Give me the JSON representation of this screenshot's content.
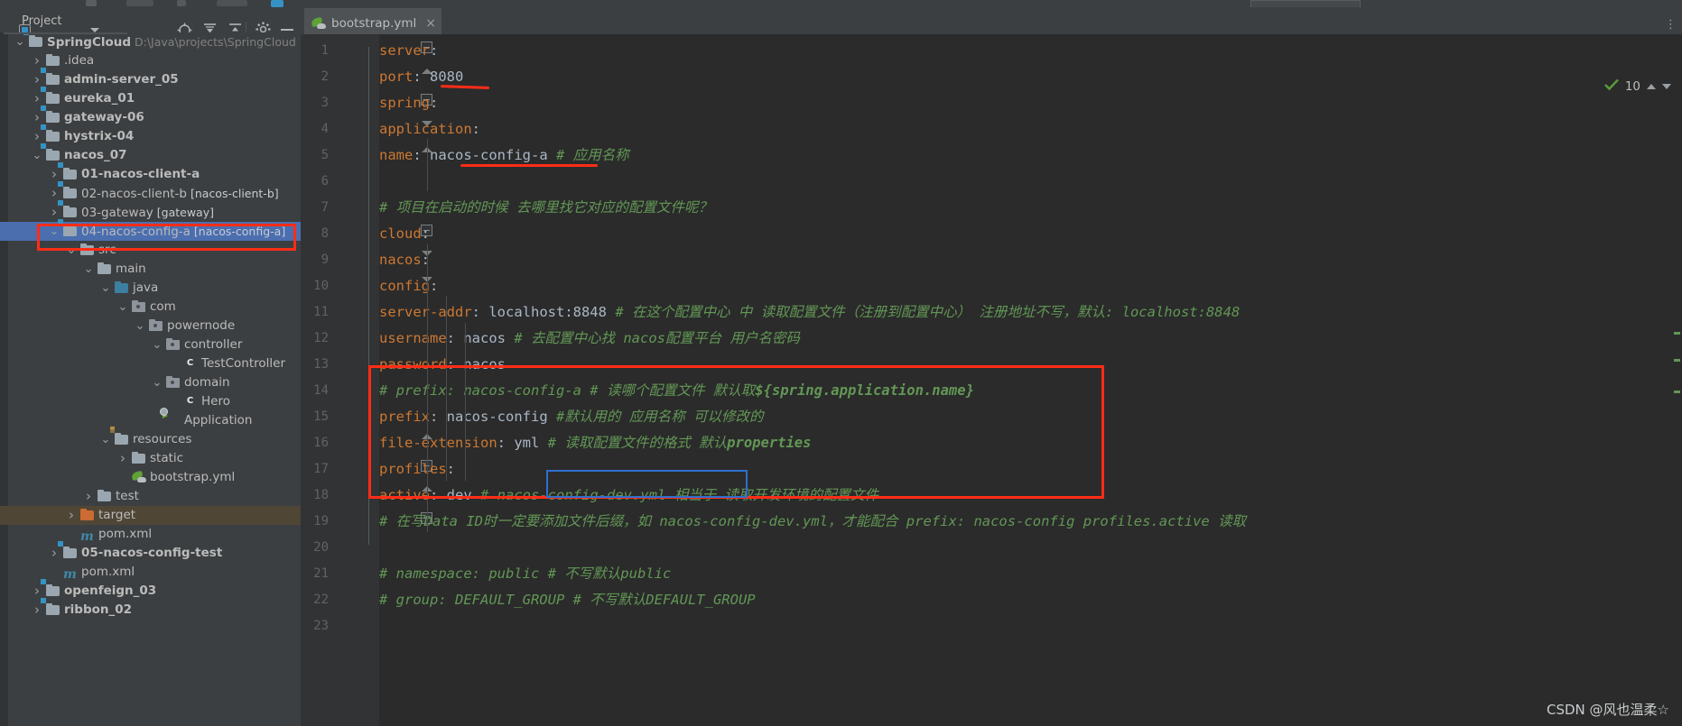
{
  "window": {
    "project_panel_title": "Project",
    "project_icon": "project-window-icon",
    "header_icons": [
      "locate-icon",
      "expand-all-icon",
      "collapse-all-icon",
      "settings-gear-icon",
      "hide-icon"
    ]
  },
  "tabs": [
    {
      "label": "bootstrap.yml",
      "icon": "yaml-file-icon",
      "close": "×",
      "active": true
    }
  ],
  "inspections": {
    "count": "10",
    "icon": "check-mark-icon"
  },
  "tree": [
    {
      "indent": 0,
      "twisty": "⌄",
      "icon": "module-folder-icon",
      "label": "SpringCloud",
      "bold": true,
      "dim": "D:\\Java\\projects\\SpringCloud"
    },
    {
      "indent": 1,
      "twisty": "›",
      "icon": "folder-icon",
      "label": ".idea",
      "bold": false,
      "dim": ""
    },
    {
      "indent": 1,
      "twisty": "›",
      "icon": "module-folder-icon",
      "label": "admin-server_05",
      "bold": true,
      "dim": ""
    },
    {
      "indent": 1,
      "twisty": "›",
      "icon": "module-folder-icon",
      "label": "eureka_01",
      "bold": true,
      "dim": ""
    },
    {
      "indent": 1,
      "twisty": "›",
      "icon": "module-folder-icon",
      "label": "gateway-06",
      "bold": true,
      "dim": ""
    },
    {
      "indent": 1,
      "twisty": "›",
      "icon": "module-folder-icon",
      "label": "hystrix-04",
      "bold": true,
      "dim": ""
    },
    {
      "indent": 1,
      "twisty": "⌄",
      "icon": "module-folder-icon",
      "label": "nacos_07",
      "bold": true,
      "dim": ""
    },
    {
      "indent": 2,
      "twisty": "›",
      "icon": "module-folder-icon",
      "label": "01-nacos-client-a",
      "bold": true,
      "dim": ""
    },
    {
      "indent": 2,
      "twisty": "›",
      "icon": "module-folder-icon",
      "label": "02-nacos-client-b",
      "bold": false,
      "dim": "[nacos-client-b]",
      "dim_bold": true
    },
    {
      "indent": 2,
      "twisty": "›",
      "icon": "module-folder-icon",
      "label": "03-gateway",
      "bold": false,
      "dim": "[gateway]",
      "dim_bold": true
    },
    {
      "indent": 2,
      "twisty": "⌄",
      "icon": "module-folder-icon",
      "label": "04-nacos-config-a",
      "bold": false,
      "dim": "[nacos-config-a]",
      "dim_bold": true,
      "selected": true
    },
    {
      "indent": 3,
      "twisty": "⌄",
      "icon": "folder-icon",
      "label": "src",
      "bold": false,
      "dim": ""
    },
    {
      "indent": 4,
      "twisty": "⌄",
      "icon": "folder-icon",
      "label": "main",
      "bold": false,
      "dim": ""
    },
    {
      "indent": 5,
      "twisty": "⌄",
      "icon": "source-folder-icon",
      "label": "java",
      "bold": false,
      "dim": ""
    },
    {
      "indent": 6,
      "twisty": "⌄",
      "icon": "package-icon",
      "label": "com",
      "bold": false,
      "dim": ""
    },
    {
      "indent": 7,
      "twisty": "⌄",
      "icon": "package-icon",
      "label": "powernode",
      "bold": false,
      "dim": ""
    },
    {
      "indent": 8,
      "twisty": "⌄",
      "icon": "package-icon",
      "label": "controller",
      "bold": false,
      "dim": ""
    },
    {
      "indent": 9,
      "twisty": "",
      "icon": "java-class-icon",
      "label": "TestController",
      "bold": false,
      "dim": ""
    },
    {
      "indent": 8,
      "twisty": "⌄",
      "icon": "package-icon",
      "label": "domain",
      "bold": false,
      "dim": ""
    },
    {
      "indent": 9,
      "twisty": "",
      "icon": "java-class-icon",
      "label": "Hero",
      "bold": false,
      "dim": ""
    },
    {
      "indent": 8,
      "twisty": "",
      "icon": "spring-boot-app-icon",
      "label": "Application",
      "bold": false,
      "dim": ""
    },
    {
      "indent": 5,
      "twisty": "⌄",
      "icon": "resources-folder-icon",
      "label": "resources",
      "bold": false,
      "dim": ""
    },
    {
      "indent": 6,
      "twisty": "›",
      "icon": "folder-icon",
      "label": "static",
      "bold": false,
      "dim": ""
    },
    {
      "indent": 6,
      "twisty": "",
      "icon": "yaml-file-icon",
      "label": "bootstrap.yml",
      "bold": false,
      "dim": ""
    },
    {
      "indent": 4,
      "twisty": "›",
      "icon": "folder-icon",
      "label": "test",
      "bold": false,
      "dim": ""
    },
    {
      "indent": 3,
      "twisty": "›",
      "icon": "target-folder-icon",
      "label": "target",
      "bold": false,
      "dim": "",
      "highlight": true
    },
    {
      "indent": 3,
      "twisty": "",
      "icon": "maven-pom-icon",
      "label": "pom.xml",
      "bold": false,
      "dim": ""
    },
    {
      "indent": 2,
      "twisty": "›",
      "icon": "module-folder-icon",
      "label": "05-nacos-config-test",
      "bold": true,
      "dim": ""
    },
    {
      "indent": 2,
      "twisty": "",
      "icon": "maven-pom-icon",
      "label": "pom.xml",
      "bold": false,
      "dim": ""
    },
    {
      "indent": 1,
      "twisty": "›",
      "icon": "module-folder-icon",
      "label": "openfeign_03",
      "bold": true,
      "dim": ""
    },
    {
      "indent": 1,
      "twisty": "›",
      "icon": "module-folder-icon",
      "label": "ribbon_02",
      "bold": true,
      "dim": ""
    }
  ],
  "editor": {
    "filename": "bootstrap.yml",
    "lines": [
      {
        "n": "1",
        "segs": [
          {
            "t": "server",
            "c": "k"
          },
          {
            "t": ":",
            "c": "p"
          }
        ],
        "indent": 0
      },
      {
        "n": "2",
        "segs": [
          {
            "t": "  port",
            "c": "k"
          },
          {
            "t": ": ",
            "c": "p"
          },
          {
            "t": "8080",
            "c": "v"
          }
        ],
        "indent": 0
      },
      {
        "n": "3",
        "segs": [
          {
            "t": "spring",
            "c": "k"
          },
          {
            "t": ":",
            "c": "p"
          }
        ],
        "indent": 0
      },
      {
        "n": "4",
        "segs": [
          {
            "t": "  application",
            "c": "k"
          },
          {
            "t": ":",
            "c": "p"
          }
        ],
        "indent": 0
      },
      {
        "n": "5",
        "segs": [
          {
            "t": "    name",
            "c": "k"
          },
          {
            "t": ": ",
            "c": "p"
          },
          {
            "t": "nacos-config-a",
            "c": "v"
          },
          {
            "t": " # 应用名称",
            "c": "c"
          }
        ],
        "indent": 0
      },
      {
        "n": "6",
        "segs": [],
        "indent": 0
      },
      {
        "n": "7",
        "segs": [
          {
            "t": "  # 项目在启动的时候  去哪里找它对应的配置文件呢？",
            "c": "c"
          }
        ],
        "indent": 0
      },
      {
        "n": "8",
        "segs": [
          {
            "t": "  cloud",
            "c": "k"
          },
          {
            "t": ":",
            "c": "p"
          }
        ],
        "indent": 0
      },
      {
        "n": "9",
        "segs": [
          {
            "t": "    nacos",
            "c": "k"
          },
          {
            "t": ":",
            "c": "p"
          }
        ],
        "indent": 0
      },
      {
        "n": "10",
        "segs": [
          {
            "t": "      config",
            "c": "k"
          },
          {
            "t": ":",
            "c": "p"
          }
        ],
        "indent": 0
      },
      {
        "n": "11",
        "segs": [
          {
            "t": "        server-addr",
            "c": "k"
          },
          {
            "t": ": ",
            "c": "p"
          },
          {
            "t": "localhost:8848",
            "c": "v"
          },
          {
            "t": "     # 在这个配置中心 中 读取配置文件（注册到配置中心）  注册地址不写，默认: localhost:8848",
            "c": "c"
          }
        ],
        "indent": 0
      },
      {
        "n": "12",
        "segs": [
          {
            "t": "        username",
            "c": "k"
          },
          {
            "t": ": ",
            "c": "p"
          },
          {
            "t": "nacos",
            "c": "v"
          },
          {
            "t": "    # 去配置中心找 nacos配置平台 用户名密码",
            "c": "c"
          }
        ],
        "indent": 0
      },
      {
        "n": "13",
        "segs": [
          {
            "t": "        password",
            "c": "k"
          },
          {
            "t": ": ",
            "c": "p"
          },
          {
            "t": "nacos",
            "c": "v"
          }
        ],
        "indent": 0
      },
      {
        "n": "14",
        "segs": [
          {
            "t": "#        prefix: nacos-config-a # 读哪个配置文件    默认取",
            "c": "c"
          },
          {
            "t": "${spring.application.name}",
            "c": "cb"
          }
        ],
        "indent": 0
      },
      {
        "n": "15",
        "segs": [
          {
            "t": "        prefix",
            "c": "k"
          },
          {
            "t": ": ",
            "c": "p"
          },
          {
            "t": "nacos-config",
            "c": "v"
          },
          {
            "t": " #默认用的 应用名称 可以修改的",
            "c": "c"
          }
        ],
        "indent": 0
      },
      {
        "n": "16",
        "segs": [
          {
            "t": "        file-extension",
            "c": "k"
          },
          {
            "t": ": ",
            "c": "p"
          },
          {
            "t": "yml",
            "c": "v"
          },
          {
            "t": "    # 读取配置文件的格式    默认",
            "c": "c"
          },
          {
            "t": "properties",
            "c": "cb"
          }
        ],
        "indent": 0
      },
      {
        "n": "17",
        "segs": [
          {
            "t": "    profiles",
            "c": "k"
          },
          {
            "t": ":",
            "c": "p"
          }
        ],
        "indent": 0
      },
      {
        "n": "18",
        "segs": [
          {
            "t": "      active",
            "c": "k"
          },
          {
            "t": ": ",
            "c": "p"
          },
          {
            "t": "dev",
            "c": "v"
          },
          {
            "t": "   # ",
            "c": "c"
          },
          {
            "t": "nacos-config-dev.yml",
            "c": "c"
          },
          {
            "t": "  相当于  读取开发环境的配置文件",
            "c": "c"
          }
        ],
        "indent": 0
      },
      {
        "n": "19",
        "segs": [
          {
            "t": "      # 在写Data ID时一定要添加文件后缀，如 nacos-config-dev.yml，才能配合 prefix: nacos-config  profiles.active 读取",
            "c": "c"
          }
        ],
        "indent": 0
      },
      {
        "n": "20",
        "segs": [],
        "indent": 0
      },
      {
        "n": "21",
        "segs": [
          {
            "t": "#        namespace: public   #  不写默认public",
            "c": "c"
          }
        ],
        "indent": 0
      },
      {
        "n": "22",
        "segs": [
          {
            "t": "#        group: DEFAULT_GROUP #  不写默认DEFAULT_GROUP",
            "c": "c"
          }
        ],
        "indent": 0
      },
      {
        "n": "23",
        "segs": [],
        "indent": 0
      }
    ]
  },
  "annotations": {
    "red_box_tree_label": "04-nacos-config-a [nacos-config-a]",
    "red_box_code_label": "lines 14-18 prefix/file-extension/profiles block",
    "blue_box_label": "nacos-config-dev.yml",
    "underline_port": "8080",
    "underline_name": "nacos-config-a"
  },
  "watermark": "CSDN @风也温柔☆"
}
